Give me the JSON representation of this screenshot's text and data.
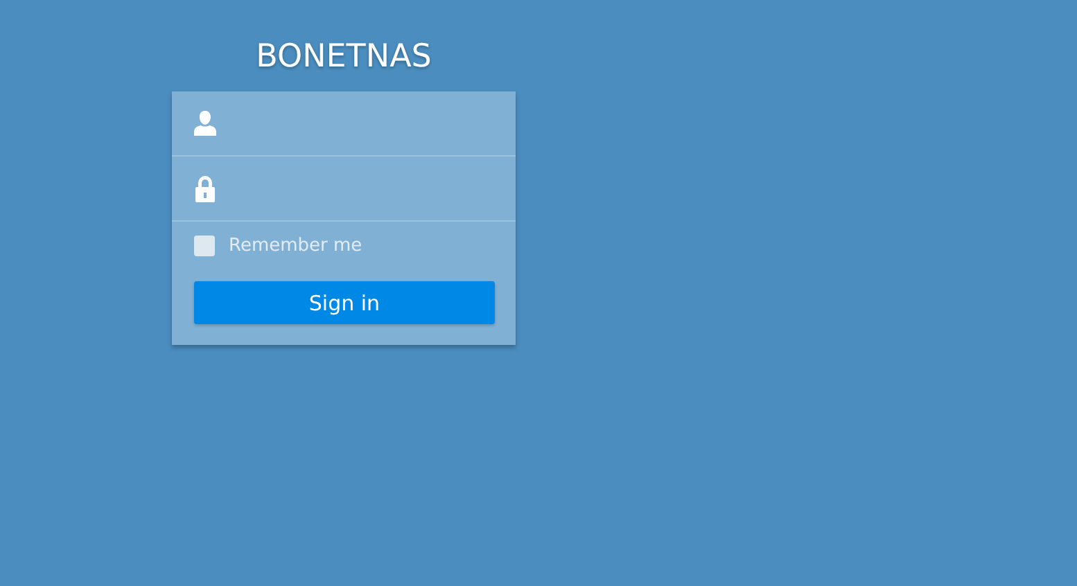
{
  "title": "BONETNAS",
  "fields": [
    {
      "kind": "user"
    },
    {
      "kind": "password"
    }
  ],
  "remember": {
    "label": "Remember me",
    "checked": false
  },
  "button": "Sign in"
}
